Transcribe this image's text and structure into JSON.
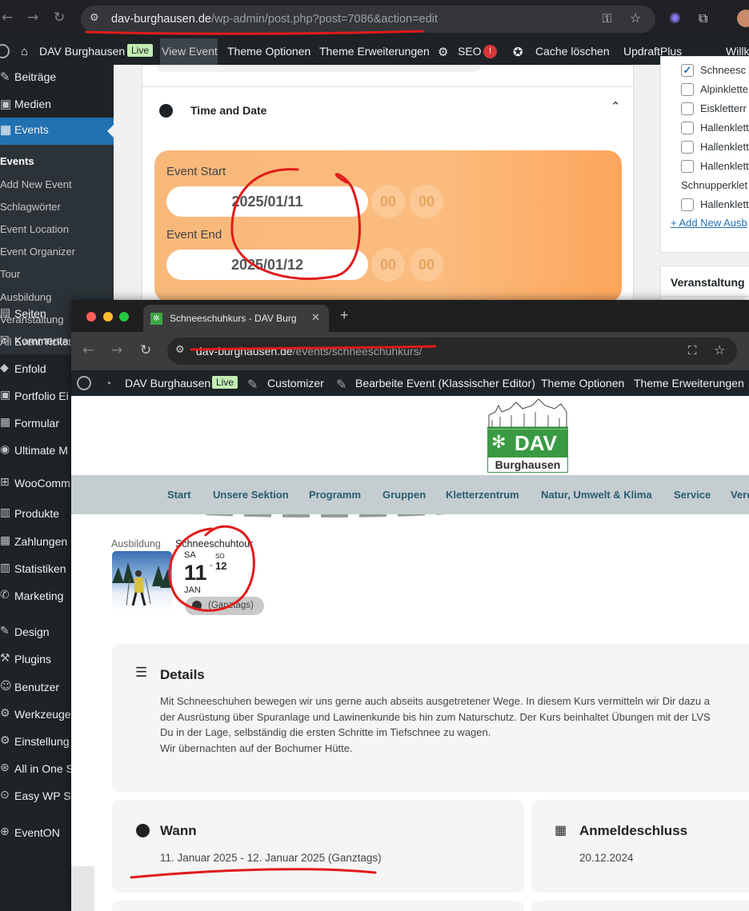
{
  "back_browser": {
    "url_host": "dav-burghausen.de",
    "url_path": "/wp-admin/post.php?post=7086&action=edit"
  },
  "admin_bar": {
    "site_name": "DAV Burghausen",
    "live_badge": "Live",
    "view_event": "View Event",
    "theme_options": "Theme Optionen",
    "theme_extensions": "Theme Erweiterungen",
    "seo": "SEO",
    "seo_count": "!",
    "cache": "Cache löschen",
    "updraft": "UpdraftPlus",
    "greeting": "Willk"
  },
  "sidebar": {
    "items_top": [
      "Beiträge",
      "Medien",
      "Events"
    ],
    "events_submenu": [
      "Events",
      "Add New Event",
      "Schlagwörter",
      "Event Location",
      "Event Organizer",
      "Tour",
      "Ausbildung",
      "Veranstaltung",
      "All Event Ticket"
    ],
    "items_bottom": [
      "Seiten",
      "Kommenta",
      "Enfold",
      "Portfolio Ei",
      "Formular",
      "Ultimate M",
      "WooComm",
      "Produkte",
      "Zahlungen",
      "Statistiken",
      "Marketing",
      "Design",
      "Plugins",
      "Benutzer",
      "Werkzeuge",
      "Einstellung",
      "All in One S",
      "Easy WP S",
      "EventON"
    ]
  },
  "editor": {
    "section_title": "Time and Date",
    "event_start_label": "Event Start",
    "event_start_date": "2025/01/11",
    "event_start_hour": "00",
    "event_start_min": "00",
    "event_end_label": "Event End",
    "event_end_date": "2025/01/12",
    "event_end_hour": "00",
    "event_end_min": "00"
  },
  "categories": {
    "items": [
      "Schneesc",
      "Alpinklette",
      "Eiskletterr",
      "Hallenklett",
      "Hallenklett",
      "Hallenklett",
      "Schnupperklet",
      "Hallenklett"
    ],
    "checked": [
      true,
      false,
      false,
      false,
      false,
      false,
      null,
      false
    ],
    "add_new": "+ Add New Ausb",
    "veranstaltung_title": "Veranstaltung"
  },
  "front_browser": {
    "tab_title": "Schneeschuhkurs - DAV Burg",
    "new_tab": "+",
    "url_host": "dav-burghausen.de",
    "url_path": "/events/schneeschuhkurs/"
  },
  "front_admin_bar": {
    "site_name": "DAV Burghausen",
    "live_badge": "Live",
    "customizer": "Customizer",
    "edit_event": "Bearbeite Event (Klassischer Editor)",
    "theme_options": "Theme Optionen",
    "theme_extensions": "Theme Erweiterungen"
  },
  "site": {
    "logo_dav": "DAV",
    "logo_city": "Burghausen",
    "nav": [
      "Start",
      "Unsere Sektion",
      "Programm",
      "Gruppen",
      "Kletterzentrum",
      "Natur, Umwelt & Klima",
      "Service",
      "Vere"
    ]
  },
  "event": {
    "category": "Ausbildung",
    "name": "Schneeschuhtour",
    "day_start_short": "SA",
    "day_start": "11",
    "sep": "-",
    "day_end_short": "SO",
    "day_end": "12",
    "month": "JAN",
    "allday": "(Ganztags)"
  },
  "details": {
    "title": "Details",
    "lines": [
      "Mit Schneeschuhen bewegen wir uns gerne auch abseits ausgetretener Wege. In diesem Kurs vermitteln wir Dir dazu a",
      "der Ausrüstung über Spuranlage und Lawinenkunde bis hin zum Naturschutz. Der Kurs beinhaltet Übungen mit der LVS",
      "Du in der Lage, selbständig die ersten Schritte im Tiefschnee zu wagen.",
      "Wir übernachten auf der Bochumer Hütte."
    ]
  },
  "when": {
    "title": "Wann",
    "value": "11. Januar 2025 - 12. Januar 2025 (Ganztags)"
  },
  "deadline": {
    "title": "Anmeldeschluss",
    "value": "20.12.2024"
  }
}
